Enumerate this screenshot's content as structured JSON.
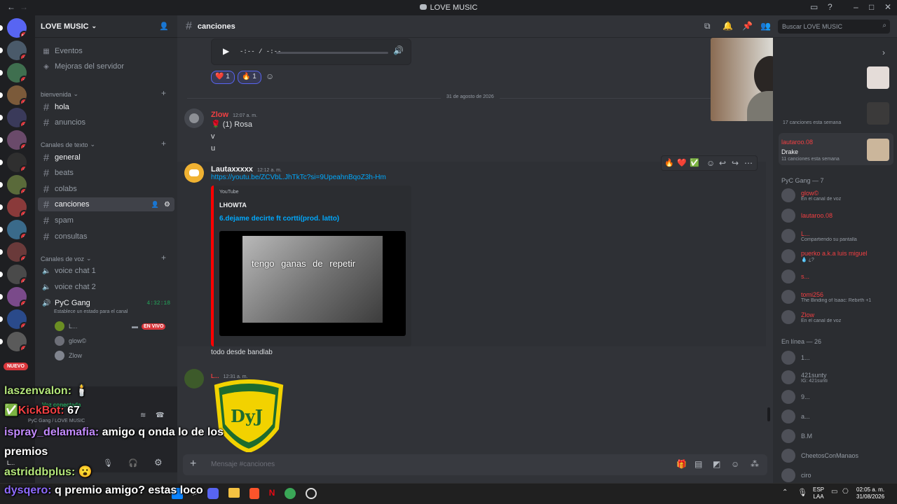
{
  "window": {
    "title": "LOVE MUSIC",
    "back": "←",
    "forward": "→"
  },
  "server": {
    "name": "LOVE MUSIC",
    "server_list_badges": [
      "11",
      "1",
      "1",
      "1",
      "1",
      "1",
      "1",
      "1",
      "1",
      "1",
      "1",
      "2",
      "1",
      "1",
      "1"
    ],
    "nuevo_label": "NUEVO"
  },
  "sidebar": {
    "top_items": [
      {
        "label": "Eventos"
      },
      {
        "label": "Mejoras del servidor"
      }
    ],
    "categories": {
      "bienvenida": "bienvenida",
      "texto": "Canales de texto",
      "voz": "Canales de voz"
    },
    "welcome_channels": [
      "hola",
      "anuncios"
    ],
    "text_channels": [
      "general",
      "beats",
      "colabs",
      "canciones",
      "spam",
      "consultas"
    ],
    "voice_channels": [
      "voice chat 1",
      "voice chat 2",
      "PyC Gang"
    ],
    "voice_timer": "4:32:18",
    "voice_status": "Establece un estado para el canal",
    "voice_users": [
      {
        "name": "L...",
        "badge": "EN VIVO"
      },
      {
        "name": "glow©"
      },
      {
        "name": "Zlow"
      }
    ]
  },
  "panel": {
    "connection": "Voz conectada",
    "location": "PyC Gang / LOVE MUSIC",
    "user": "L..."
  },
  "channel": {
    "name": "canciones",
    "search_placeholder": "Buscar LOVE MUSIC",
    "input_placeholder": "Mensaje #canciones"
  },
  "audio": {
    "time": "-:-- / -:--"
  },
  "reactions": [
    {
      "emoji": "❤️",
      "count": "1"
    },
    {
      "emoji": "🔥",
      "count": "1"
    }
  ],
  "divider": "31 de agosto de 2026",
  "messages": [
    {
      "author": "Zlow",
      "time": "12:07 a. m.",
      "lines": [
        "🌹 (1) Rosa",
        "v",
        "u"
      ]
    },
    {
      "author": "Lautaxxxxx",
      "time": "12:12 a. m.",
      "link": "https://youtu.be/ZCVbL.JhTkTc?si=9UpeahnBqoZ3h-Hm",
      "embed": {
        "provider": "YouTube",
        "author": "LHOWTA",
        "title": "6.dejame decirte ft cortti(prod. latto)",
        "caption": "tengo   ganas   de repetir"
      },
      "after": "todo desde bandlab"
    },
    {
      "author": "L...",
      "time": "12:31 a. m.",
      "logo": "DyJ"
    }
  ],
  "hover_reactions": [
    "🔥",
    "❤️",
    "✅"
  ],
  "members": {
    "weekly": [
      {
        "name": "lautaroo.08",
        "sub": "Drake",
        "stat": "11 canciones esta semana"
      },
      {
        "stat": "17 canciones esta semana"
      }
    ],
    "group_pyc": "PyC Gang — 7",
    "pyc": [
      {
        "name": "glow©",
        "status": "En el canal de voz"
      },
      {
        "name": "lautaroo.08",
        "status": ""
      },
      {
        "name": "L...",
        "status": "Compartiendo su pantalla"
      },
      {
        "name": "puerko a.k.a luis miguel",
        "status": "💧 ¿?"
      },
      {
        "name": "s...",
        "status": ""
      },
      {
        "name": "tomi256",
        "status": "The Binding of Isaac: Rebirth +1"
      },
      {
        "name": "Zlow",
        "status": "En el canal de voz"
      }
    ],
    "group_online": "En línea — 26",
    "online": [
      {
        "name": "1..."
      },
      {
        "name": "421sunty",
        "status": "IG: 421sunti"
      },
      {
        "name": "9..."
      },
      {
        "name": "a..."
      },
      {
        "name": "B.M"
      },
      {
        "name": "CheetosConManaos"
      },
      {
        "name": "ciro"
      }
    ]
  },
  "chat_overlay": [
    {
      "user": "laszenvalon:",
      "text": "🕯️"
    },
    {
      "user": "KickBot:",
      "text": "67"
    },
    {
      "user": "ispray_delamafia:",
      "text": "amigo q onda lo de los premios"
    },
    {
      "user": "astriddbplus:",
      "text": "😮"
    },
    {
      "user": "dysqero:",
      "text": "q premio amigo? estas loco"
    }
  ],
  "taskbar": {
    "lang1": "ESP",
    "lang2": "LAA",
    "time": "02:05 a. m.",
    "date": "31/08/2026"
  },
  "colors": {
    "accent": "#5865f2",
    "red": "#f23f42",
    "green": "#23a55a",
    "bg": "#313338"
  }
}
